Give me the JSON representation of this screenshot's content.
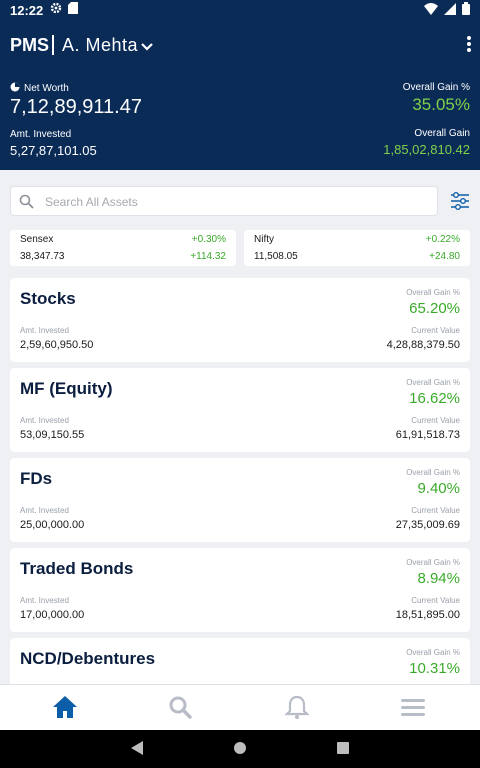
{
  "status_bar": {
    "time": "12:22"
  },
  "app_bar": {
    "brand": "PMS",
    "user": "A. Mehta"
  },
  "summary": {
    "net_worth_label": "Net Worth",
    "net_worth_value": "7,12,89,911.47",
    "overall_gain_pct_label": "Overall Gain %",
    "overall_gain_pct_value": "35.05%",
    "amt_invested_label": "Amt. Invested",
    "amt_invested_value": "5,27,87,101.05",
    "overall_gain_label": "Overall Gain",
    "overall_gain_value": "1,85,02,810.42"
  },
  "search": {
    "placeholder": "Search All Assets"
  },
  "indices": [
    {
      "name": "Sensex",
      "pct": "+0.30%",
      "value": "38,347.73",
      "change": "+114.32"
    },
    {
      "name": "Nifty",
      "pct": "+0.22%",
      "value": "11,508.05",
      "change": "+24.80"
    }
  ],
  "assets": [
    {
      "title": "Stocks",
      "gain_label": "Overall Gain %",
      "gain_value": "65.20%",
      "invested_label": "Amt. Invested",
      "invested_value": "2,59,60,950.50",
      "current_label": "Current Value",
      "current_value": "4,28,88,379.50"
    },
    {
      "title": "MF (Equity)",
      "gain_label": "Overall Gain %",
      "gain_value": "16.62%",
      "invested_label": "Amt. Invested",
      "invested_value": "53,09,150.55",
      "current_label": "Current Value",
      "current_value": "61,91,518.73"
    },
    {
      "title": "FDs",
      "gain_label": "Overall Gain %",
      "gain_value": "9.40%",
      "invested_label": "Amt. Invested",
      "invested_value": "25,00,000.00",
      "current_label": "Current Value",
      "current_value": "27,35,009.69"
    },
    {
      "title": "Traded Bonds",
      "gain_label": "Overall Gain %",
      "gain_value": "8.94%",
      "invested_label": "Amt. Invested",
      "invested_value": "17,00,000.00",
      "current_label": "Current Value",
      "current_value": "18,51,895.00"
    },
    {
      "title": "NCD/Debentures",
      "gain_label": "Overall Gain %",
      "gain_value": "10.31%"
    }
  ],
  "bottom_nav": {
    "items": [
      {
        "icon": "home-icon",
        "active": true
      },
      {
        "icon": "search-icon",
        "active": false
      },
      {
        "icon": "bell-icon",
        "active": false
      },
      {
        "icon": "menu-icon",
        "active": false
      }
    ]
  },
  "colors": {
    "header_bg": "#0b2b57",
    "gain_green": "#3aaa2a",
    "header_gain_green": "#7fd14a",
    "nav_active": "#0d5ea8",
    "nav_inactive": "#b7bcc6"
  }
}
